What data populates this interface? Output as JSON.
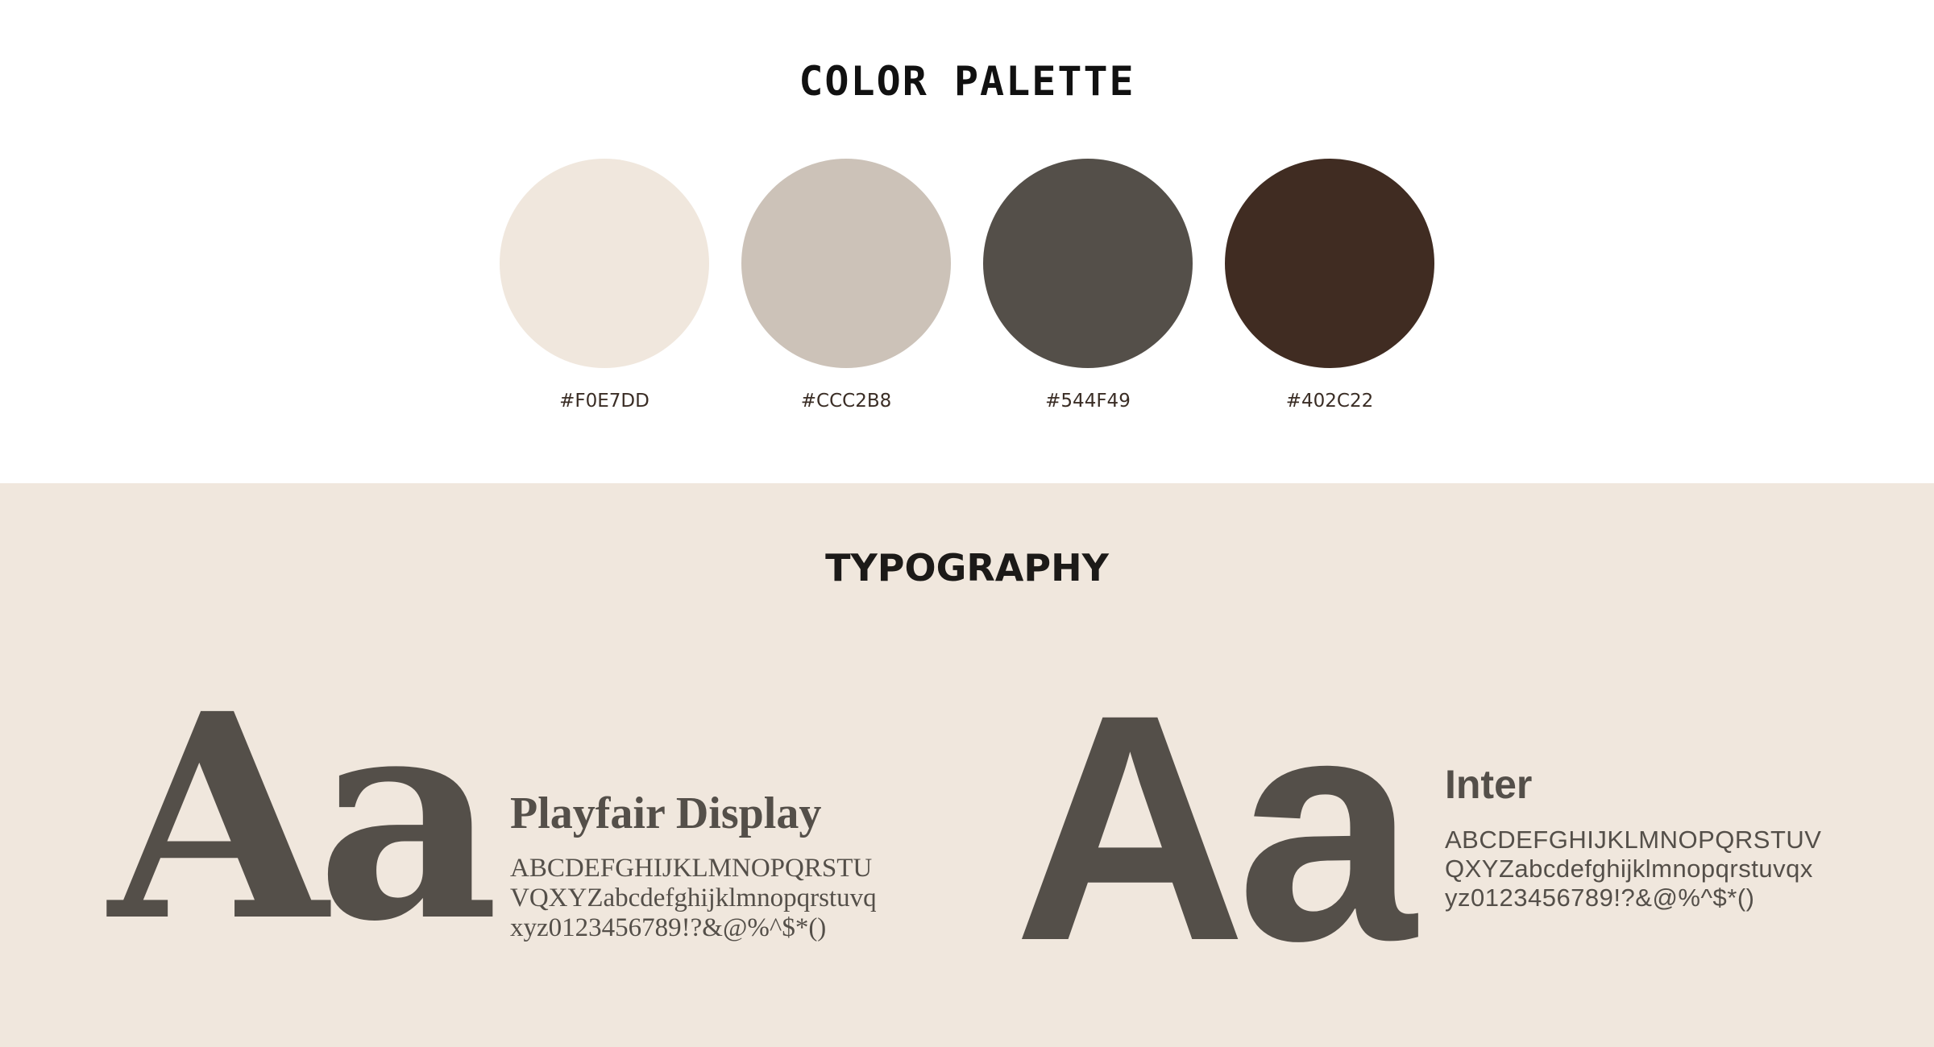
{
  "palette": {
    "title": "COLOR PALETTE",
    "swatches": [
      {
        "hex": "#F0E7DD",
        "label": "#F0E7DD"
      },
      {
        "hex": "#CCC2B8",
        "label": "#CCC2B8"
      },
      {
        "hex": "#544F49",
        "label": "#544F49"
      },
      {
        "hex": "#402C22",
        "label": "#402C22"
      }
    ]
  },
  "typography": {
    "title": "TYPOGRAPHY",
    "background": "#F0E7DD",
    "text_color": "#544F49",
    "fonts": [
      {
        "specimen": "Aa",
        "name": "Playfair Display",
        "glyphs": "ABCDEFGHIJKLMNOPQRSTUVQXYZabcdefghijklmnopqrstuvqxyz0123456789!?&@%^$*()"
      },
      {
        "specimen": "Aa",
        "name": "Inter",
        "glyphs": "ABCDEFGHIJKLMNOPQRSTUVQXYZabcdefghijklmnopqrstuvqxyz0123456789!?&@%^$*()"
      }
    ]
  }
}
